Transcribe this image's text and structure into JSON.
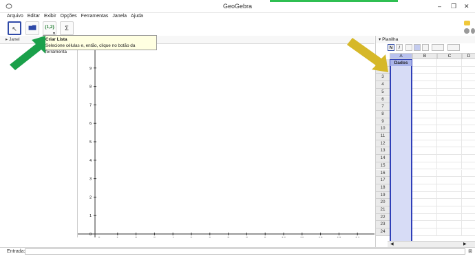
{
  "window": {
    "title": "GeoGebra",
    "controls": [
      "–",
      "❐",
      "✕"
    ]
  },
  "menu": [
    "Arquivo",
    "Editar",
    "Exibir",
    "Opções",
    "Ferramentas",
    "Janela",
    "Ajuda"
  ],
  "toolbar": {
    "tools": [
      {
        "name": "move-tool",
        "glyph": "↖",
        "selected": true
      },
      {
        "name": "one-variable-analysis-tool",
        "glyph": "▆▇"
      },
      {
        "name": "create-list-tool",
        "glyph": "{1,2}"
      },
      {
        "name": "sum-tool",
        "glyph": "Σ"
      }
    ]
  },
  "tooltip": {
    "title": "Criar Lista",
    "text": "Selecione células e, então, clique no botão da ferramenta"
  },
  "left_panel": {
    "title": "Janel"
  },
  "graphics": {
    "y_ticks": [
      "0",
      "1",
      "2",
      "3",
      "4",
      "5",
      "6",
      "7",
      "8",
      "9"
    ],
    "x_ticks": [
      "0",
      "1",
      "2",
      "3",
      "4",
      "5",
      "6",
      "7",
      "8",
      "9",
      "10",
      "11",
      "12",
      "13",
      "14"
    ]
  },
  "spreadsheet": {
    "title": "Planilha",
    "format_buttons": [
      "N",
      "I"
    ],
    "columns": [
      "A",
      "B",
      "C",
      "D"
    ],
    "rows": [
      "1",
      "2",
      "3",
      "4",
      "5",
      "6",
      "7",
      "8",
      "9",
      "10",
      "11",
      "12",
      "13",
      "14",
      "15",
      "16",
      "17",
      "18",
      "19",
      "20",
      "21",
      "22",
      "23",
      "24"
    ],
    "cell_A1": "Dados"
  },
  "input_bar": {
    "label": "Entrada:"
  },
  "colors": {
    "selection_border": "#2f3fb8",
    "selection_fill": "#d7dcf6",
    "green_arrow": "#1aa04a",
    "yellow_arrow": "#d6b829"
  }
}
